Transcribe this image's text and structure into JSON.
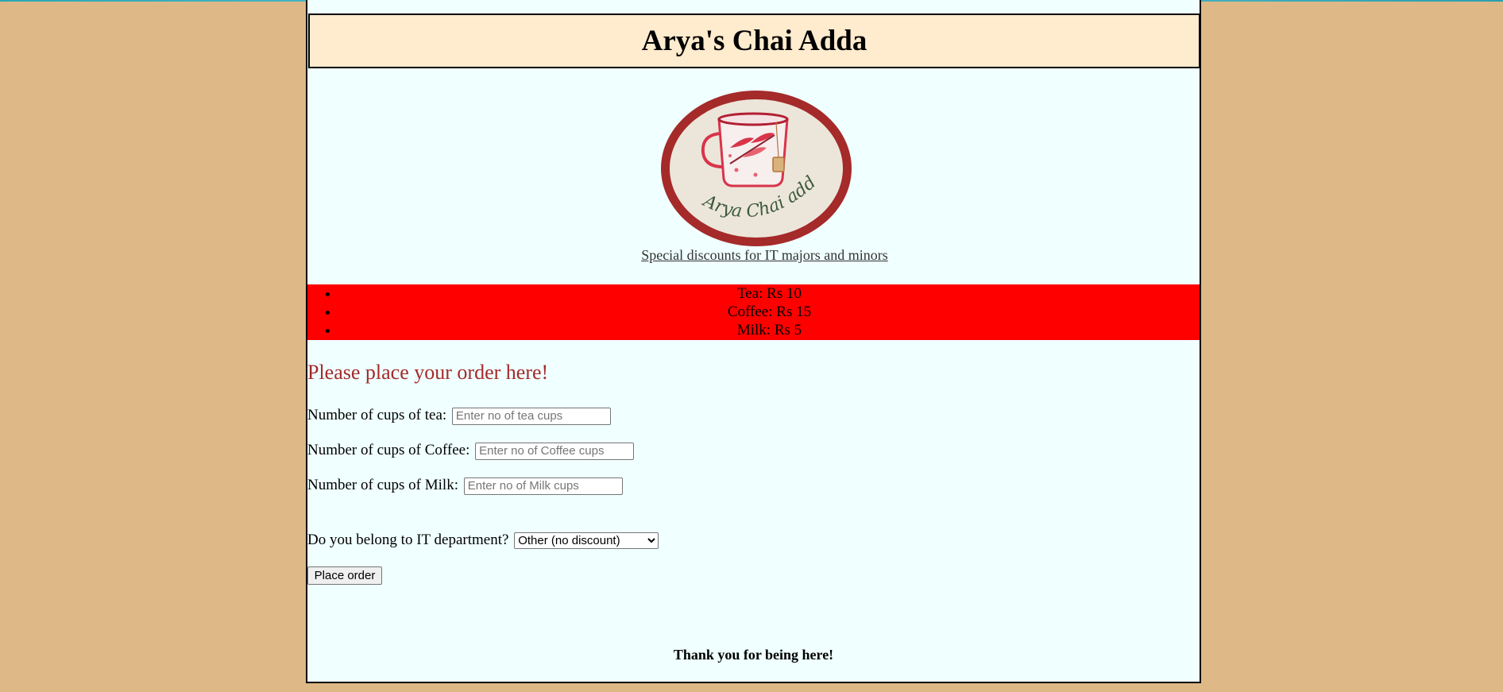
{
  "site": {
    "title": "Arya's Chai Adda",
    "logo_text": "Arya Chai adda",
    "tagline": "Special discounts for IT majors and minors"
  },
  "menu": {
    "items": [
      {
        "label": "Tea: Rs 10"
      },
      {
        "label": "Coffee: Rs 15"
      },
      {
        "label": "Milk: Rs 5"
      }
    ]
  },
  "order_form": {
    "heading": "Please place your order here!",
    "tea": {
      "label": "Number of cups of tea:",
      "placeholder": "Enter no of tea cups",
      "value": ""
    },
    "coffee": {
      "label": "Number of cups of Coffee:",
      "placeholder": "Enter no of Coffee cups",
      "value": ""
    },
    "milk": {
      "label": "Number of cups of Milk:",
      "placeholder": "Enter no of Milk cups",
      "value": ""
    },
    "department": {
      "label": "Do you belong to IT department?",
      "selected": "Other (no discount)"
    },
    "submit_label": "Place order"
  },
  "footer": {
    "text": "Thank you for being here!"
  },
  "colors": {
    "background": "#deb887",
    "page": "#f0ffff",
    "header": "#ffebcd",
    "menu": "#ff0000",
    "heading": "#a52a2a"
  }
}
